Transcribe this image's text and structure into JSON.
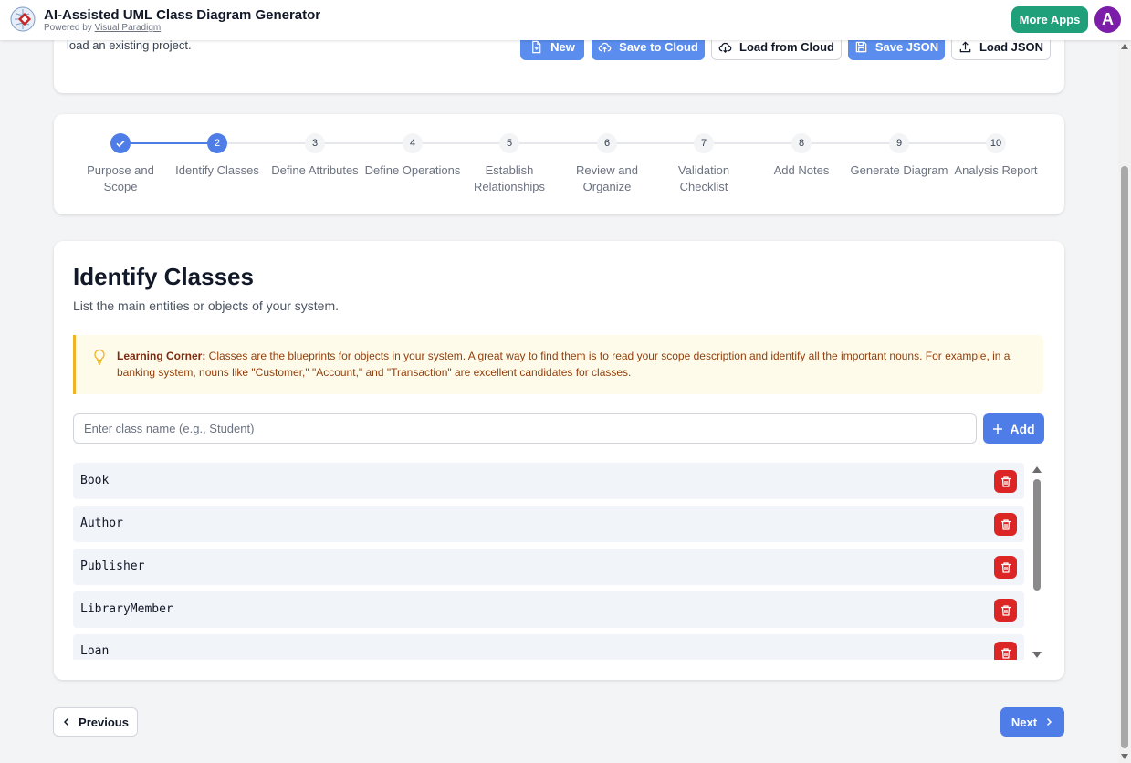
{
  "app": {
    "title": "AI-Assisted UML Class Diagram Generator",
    "powered_prefix": "Powered by",
    "powered_link": "Visual Paradigm",
    "more_apps": "More Apps",
    "avatar_letter": "A"
  },
  "project": {
    "description": "load an existing project.",
    "buttons": {
      "new": "New",
      "save_cloud": "Save to Cloud",
      "load_cloud": "Load from Cloud",
      "save_json": "Save JSON",
      "load_json": "Load JSON"
    }
  },
  "stepper": {
    "current": 2,
    "steps": [
      {
        "number": "1",
        "label": "Purpose and Scope",
        "state": "done"
      },
      {
        "number": "2",
        "label": "Identify Classes",
        "state": "active"
      },
      {
        "number": "3",
        "label": "Define Attributes",
        "state": "pending"
      },
      {
        "number": "4",
        "label": "Define Operations",
        "state": "pending"
      },
      {
        "number": "5",
        "label": "Establish Relationships",
        "state": "pending"
      },
      {
        "number": "6",
        "label": "Review and Organize",
        "state": "pending"
      },
      {
        "number": "7",
        "label": "Validation Checklist",
        "state": "pending"
      },
      {
        "number": "8",
        "label": "Add Notes",
        "state": "pending"
      },
      {
        "number": "9",
        "label": "Generate Diagram",
        "state": "pending"
      },
      {
        "number": "10",
        "label": "Analysis Report",
        "state": "pending"
      }
    ]
  },
  "main": {
    "title": "Identify Classes",
    "subtitle": "List the main entities or objects of your system.",
    "tip": {
      "label": "Learning Corner:",
      "text": " Classes are the blueprints for objects in your system. A great way to find them is to read your scope description and identify all the important nouns. For example, in a banking system, nouns like \"Customer,\" \"Account,\" and \"Transaction\" are excellent candidates for classes."
    },
    "input": {
      "placeholder": "Enter class name (e.g., Student)",
      "value": ""
    },
    "add_label": "Add",
    "classes": [
      "Book",
      "Author",
      "Publisher",
      "LibraryMember",
      "Loan"
    ]
  },
  "nav": {
    "previous": "Previous",
    "next": "Next"
  },
  "colors": {
    "primary": "#4f7de8",
    "more_apps": "#20a07a",
    "avatar": "#7b1da8",
    "delete": "#dc2626",
    "tip_background": "#fffbea",
    "tip_border": "#f0b429"
  }
}
